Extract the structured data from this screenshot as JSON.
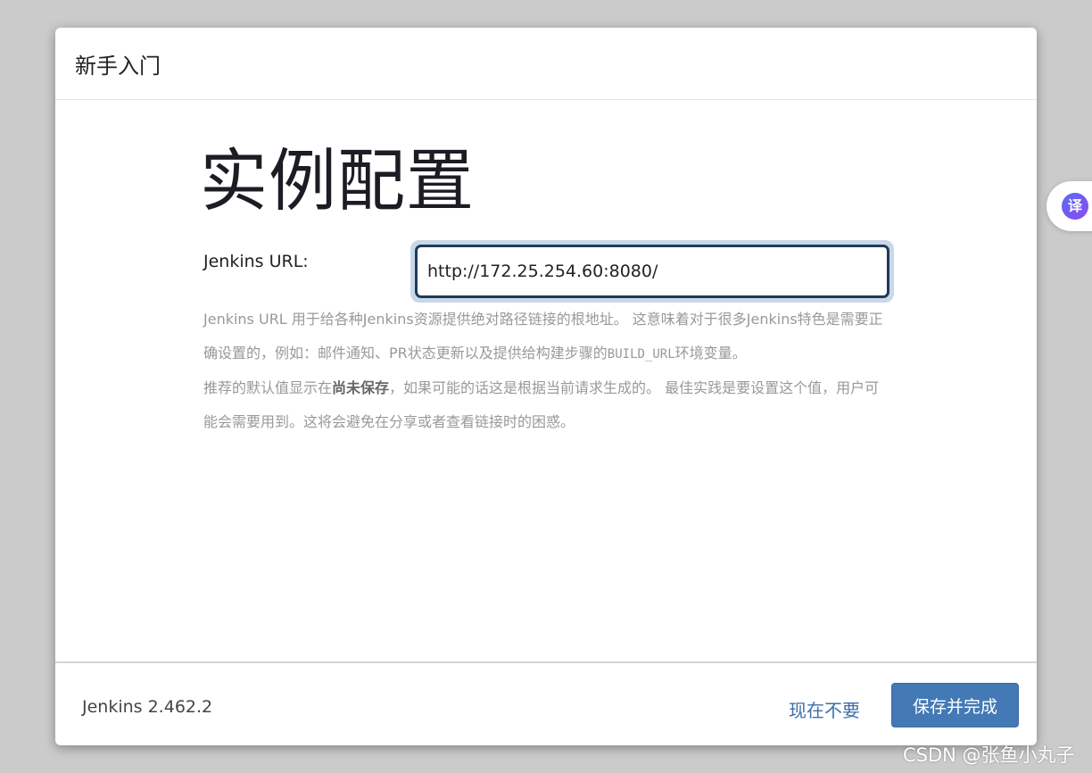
{
  "dialog": {
    "title": "新手入门"
  },
  "main": {
    "heading": "实例配置",
    "url_label": "Jenkins URL:",
    "url_value": "http://172.25.254.60:8080/",
    "description": {
      "p1_a": "Jenkins URL 用于给各种Jenkins资源提供绝对路径链接的根地址。 这意味着对于很多Jenkins特色是需要正确设置的，例如：邮件通知、PR状态更新以及提供给构建步骤的",
      "p1_code": "BUILD_URL",
      "p1_b": "环境变量。",
      "p2_a": "推荐的默认值显示在",
      "p2_bold": "尚未保存",
      "p2_b": "，如果可能的话这是根据当前请求生成的。 最佳实践是要设置这个值，用户可能会需要用到。这将会避免在分享或者查看链接时的困惑。"
    }
  },
  "footer": {
    "version": "Jenkins 2.462.2",
    "skip_label": "现在不要",
    "save_label": "保存并完成"
  },
  "translate_widget": {
    "icon": "translate-icon",
    "glyph": "译"
  },
  "watermark": "CSDN @张鱼小丸子",
  "colors": {
    "primary": "#4379b4",
    "link": "#3d6fa8",
    "input_border": "#1f3a5a",
    "input_focus_ring": "#c9d8e8",
    "overlay": "#cbcbcb"
  }
}
